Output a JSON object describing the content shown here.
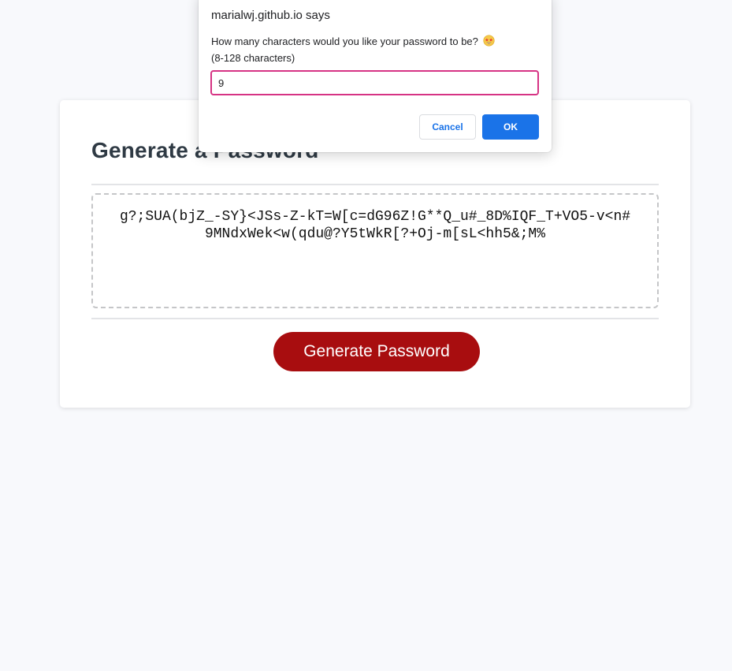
{
  "card": {
    "title": "Generate a Password",
    "generated_password": "g?;SUA(bjZ_-SY}<JSs-Z-kT=W[c=dG96Z!G**Q_u#_8D%IQF_T+VO5-v<n#9MNdxWek<w(qdu@?Y5tWkR[?+Oj-m[sL<hh5&;M%",
    "generate_button_label": "Generate Password",
    "colors": {
      "button": "#a80d0f",
      "title": "#2f3a44"
    }
  },
  "dialog": {
    "title": "marialwj.github.io says",
    "message_line1": "How many characters would you like your password to be?",
    "message_line2": "(8-128 characters)",
    "emoji_icon": "star-struck-emoji-icon",
    "input_value": "9",
    "cancel_label": "Cancel",
    "ok_label": "OK",
    "colors": {
      "accent": "#1a73e8",
      "input_focus_border": "#d63384"
    }
  }
}
